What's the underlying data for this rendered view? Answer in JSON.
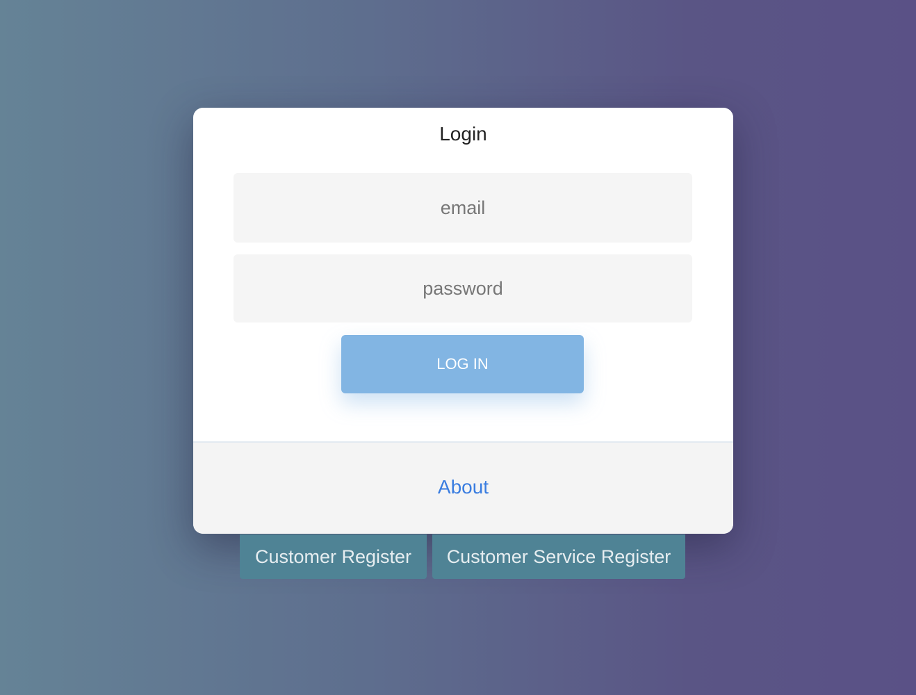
{
  "login_card": {
    "title": "Login",
    "email_placeholder": "email",
    "password_placeholder": "password",
    "login_button": "LOG IN",
    "about_link": "About"
  },
  "register": {
    "customer": "Customer Register",
    "customer_service": "Customer Service Register"
  },
  "colors": {
    "login_button": "#82b5e3",
    "link": "#3a7de0",
    "register_button": "#4f8395"
  }
}
